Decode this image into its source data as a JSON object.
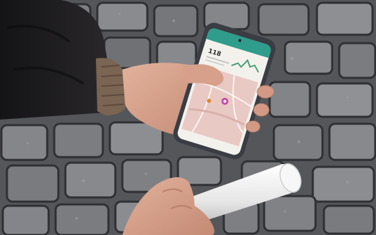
{
  "photo": {
    "subject": "",
    "colors": {
      "pavement": "#5e5f63",
      "stone_light": "#8c8d91",
      "stone_dark": "#4a4b4f",
      "sleeve": "#1d1c1e",
      "cuff": "#7a6452",
      "skin": "#d9a48e",
      "skin_shadow": "#b97f6b",
      "phone_body": "#3a3d44",
      "screen_bg": "#f3f1ec",
      "app_header": "#2f9c8c",
      "chart_line": "#3a9a6a",
      "map_tint": "#e9c9c4",
      "tube": "#f1f1f1"
    }
  },
  "phone_screen": {
    "status_time": "",
    "header_title": "",
    "reading_value": "118",
    "map_marker_icon": "map-pin-icon"
  }
}
